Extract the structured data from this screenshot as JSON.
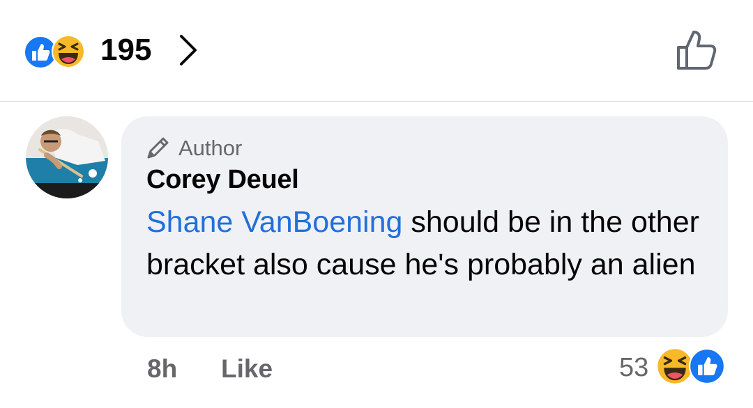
{
  "reactions": {
    "count": "195",
    "icons": [
      "like-icon",
      "haha-icon"
    ],
    "like_color": "#1877f2",
    "haha_color": "#f7b928"
  },
  "comment": {
    "badge": "Author",
    "author": "Corey Deuel",
    "mention": "Shane VanBoening",
    "text": " should be in the other bracket also cause he's probably an alien",
    "mention_color": "#216fdb"
  },
  "meta": {
    "time": "8h",
    "like_label": "Like",
    "reaction_count": "53"
  }
}
